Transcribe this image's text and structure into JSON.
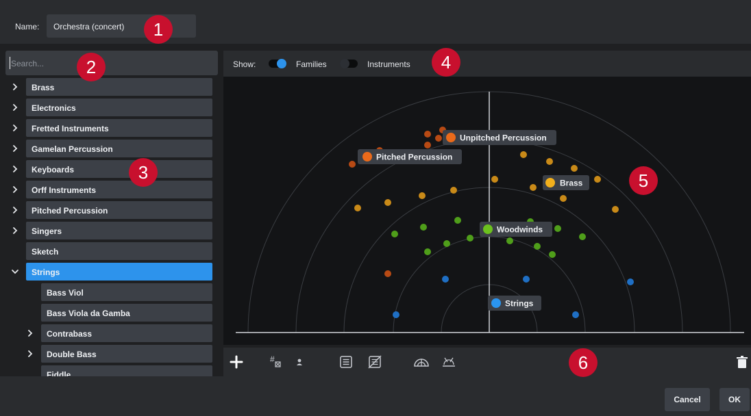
{
  "name_field": {
    "label": "Name:",
    "value": "Orchestra (concert)"
  },
  "search": {
    "placeholder": "Search..."
  },
  "tree": [
    {
      "label": "Brass",
      "expandable": true,
      "expanded": false,
      "level": 0
    },
    {
      "label": "Electronics",
      "expandable": true,
      "expanded": false,
      "level": 0
    },
    {
      "label": "Fretted Instruments",
      "expandable": true,
      "expanded": false,
      "level": 0
    },
    {
      "label": "Gamelan Percussion",
      "expandable": true,
      "expanded": false,
      "level": 0
    },
    {
      "label": "Keyboards",
      "expandable": true,
      "expanded": false,
      "level": 0
    },
    {
      "label": "Orff Instruments",
      "expandable": true,
      "expanded": false,
      "level": 0
    },
    {
      "label": "Pitched Percussion",
      "expandable": true,
      "expanded": false,
      "level": 0
    },
    {
      "label": "Singers",
      "expandable": true,
      "expanded": false,
      "level": 0
    },
    {
      "label": "Sketch",
      "expandable": false,
      "expanded": false,
      "level": 0
    },
    {
      "label": "Strings",
      "expandable": true,
      "expanded": true,
      "level": 0,
      "selected": true
    },
    {
      "label": "Bass Viol",
      "expandable": false,
      "expanded": false,
      "level": 1
    },
    {
      "label": "Bass Viola da Gamba",
      "expandable": false,
      "expanded": false,
      "level": 1
    },
    {
      "label": "Contrabass",
      "expandable": true,
      "expanded": false,
      "level": 1
    },
    {
      "label": "Double Bass",
      "expandable": true,
      "expanded": false,
      "level": 1
    },
    {
      "label": "Fiddle",
      "expandable": false,
      "expanded": false,
      "level": 1
    }
  ],
  "show": {
    "label": "Show:",
    "families": {
      "label": "Families",
      "on": true
    },
    "instruments": {
      "label": "Instruments",
      "on": false
    }
  },
  "family_labels": {
    "unpitched": "Unpitched Percussion",
    "pitched": "Pitched Percussion",
    "brass": "Brass",
    "woodwinds": "Woodwinds",
    "strings": "Strings"
  },
  "colors": {
    "unpitched": "#ea6a1a",
    "pitched": "#ea6a1a",
    "brass": "#f2b01c",
    "woodwinds": "#6cc11e",
    "strings": "#2a95f0",
    "dot_unpitched": "#b84a14",
    "dot_brass": "#c98a18",
    "dot_woodwinds": "#4f9e1a",
    "dot_strings": "#1f6fc4",
    "accent": "#2d93ec",
    "callout": "#c8102e"
  },
  "toolbar": {
    "icons": [
      "plus-icon",
      "numbered-rename-icon",
      "single-player-icon",
      "notes-icon",
      "clear-notes-icon",
      "stage-icon",
      "stage-adjust-icon",
      "trash-icon"
    ]
  },
  "buttons": {
    "cancel": "Cancel",
    "ok": "OK"
  },
  "callouts": [
    "1",
    "2",
    "3",
    "4",
    "5",
    "6"
  ]
}
